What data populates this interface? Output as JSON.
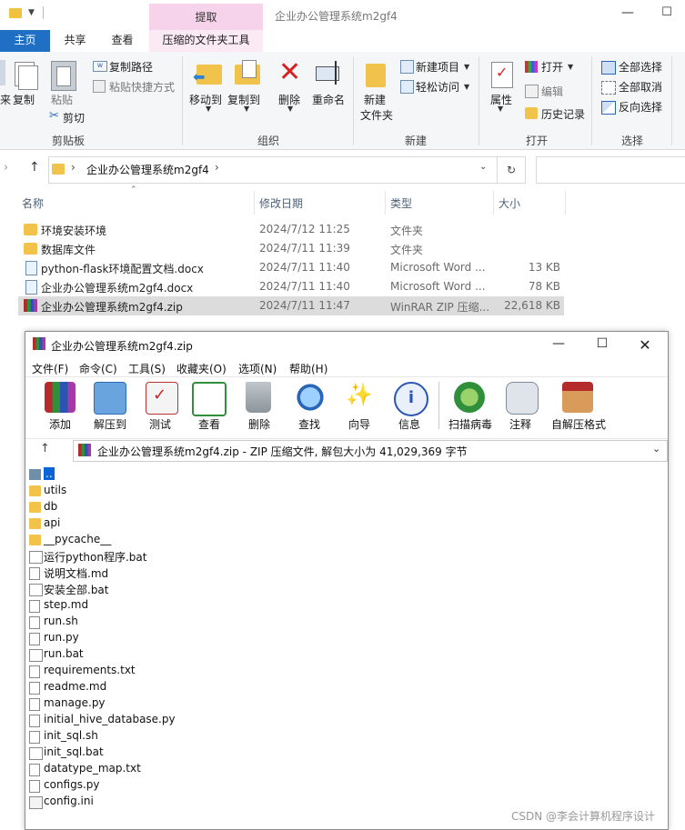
{
  "explorer": {
    "title": "企业办公管理系统m2gf4",
    "context_tab": "提取",
    "tabs": [
      "主页",
      "共享",
      "查看",
      "压缩的文件夹工具"
    ],
    "ribbon": {
      "clipboard": {
        "group": "剪贴板",
        "copy": "复制",
        "paste": "粘贴",
        "copy_path": "复制路径",
        "paste_shortcut": "粘贴快捷方式",
        "cut": "剪切"
      },
      "organize": {
        "group": "组织",
        "move_to": "移动到",
        "copy_to": "复制到",
        "delete": "删除",
        "rename": "重命名"
      },
      "new": {
        "group": "新建",
        "new_folder_l1": "新建",
        "new_folder_l2": "文件夹",
        "new_item": "新建项目",
        "easy_access": "轻松访问"
      },
      "open": {
        "group": "打开",
        "properties": "属性",
        "open": "打开",
        "edit": "编辑",
        "history": "历史记录"
      },
      "select": {
        "group": "选择",
        "select_all": "全部选择",
        "select_none": "全部取消",
        "invert": "反向选择"
      }
    },
    "address": "企业办公管理系统m2gf4",
    "columns": {
      "name": "名称",
      "date": "修改日期",
      "type": "类型",
      "size": "大小"
    },
    "files": [
      {
        "name": "环境安装环境",
        "date": "2024/7/12 11:25",
        "type": "文件夹",
        "size": "",
        "icon": "folder-icon"
      },
      {
        "name": "数据库文件",
        "date": "2024/7/11 11:39",
        "type": "文件夹",
        "size": "",
        "icon": "folder-icon"
      },
      {
        "name": "python-flask环境配置文档.docx",
        "date": "2024/7/11 11:40",
        "type": "Microsoft Word ...",
        "size": "13 KB",
        "icon": "word-doc-icon"
      },
      {
        "name": "企业办公管理系统m2gf4.docx",
        "date": "2024/7/11 11:40",
        "type": "Microsoft Word ...",
        "size": "78 KB",
        "icon": "word-doc-icon"
      },
      {
        "name": "企业办公管理系统m2gf4.zip",
        "date": "2024/7/11 11:47",
        "type": "WinRAR ZIP 压缩...",
        "size": "22,618 KB",
        "icon": "winrar-zip-icon"
      }
    ]
  },
  "winrar": {
    "title": "企业办公管理系统m2gf4.zip",
    "menu": [
      "文件(F)",
      "命令(C)",
      "工具(S)",
      "收藏夹(O)",
      "选项(N)",
      "帮助(H)"
    ],
    "toolbar": [
      "添加",
      "解压到",
      "测试",
      "查看",
      "删除",
      "查找",
      "向导",
      "信息",
      "扫描病毒",
      "注释",
      "自解压格式"
    ],
    "path": "企业办公管理系统m2gf4.zip - ZIP 压缩文件, 解包大小为 41,029,369 字节",
    "entries": [
      {
        "name": "..",
        "icon": "up-folder-icon"
      },
      {
        "name": "utils",
        "icon": "folder-icon"
      },
      {
        "name": "db",
        "icon": "folder-icon"
      },
      {
        "name": "api",
        "icon": "folder-icon"
      },
      {
        "name": "__pycache__",
        "icon": "folder-icon"
      },
      {
        "name": "运行python程序.bat",
        "icon": "bat-file-icon"
      },
      {
        "name": "说明文档.md",
        "icon": "file-icon"
      },
      {
        "name": "安装全部.bat",
        "icon": "bat-file-icon"
      },
      {
        "name": "step.md",
        "icon": "file-icon"
      },
      {
        "name": "run.sh",
        "icon": "file-icon"
      },
      {
        "name": "run.py",
        "icon": "file-icon"
      },
      {
        "name": "run.bat",
        "icon": "bat-file-icon"
      },
      {
        "name": "requirements.txt",
        "icon": "file-icon"
      },
      {
        "name": "readme.md",
        "icon": "file-icon"
      },
      {
        "name": "manage.py",
        "icon": "file-icon"
      },
      {
        "name": "initial_hive_database.py",
        "icon": "file-icon"
      },
      {
        "name": "init_sql.sh",
        "icon": "file-icon"
      },
      {
        "name": "init_sql.bat",
        "icon": "bat-file-icon"
      },
      {
        "name": "datatype_map.txt",
        "icon": "file-icon"
      },
      {
        "name": "configs.py",
        "icon": "file-icon"
      },
      {
        "name": "config.ini",
        "icon": "config-file-icon"
      }
    ]
  },
  "watermark": "CSDN @李会计算机程序设计",
  "colors": {
    "home_tab": "#1f6fc5",
    "context_tab": "#f6d3ea",
    "selected_row": "#dcdcdc",
    "folder": "#f2c34a"
  }
}
